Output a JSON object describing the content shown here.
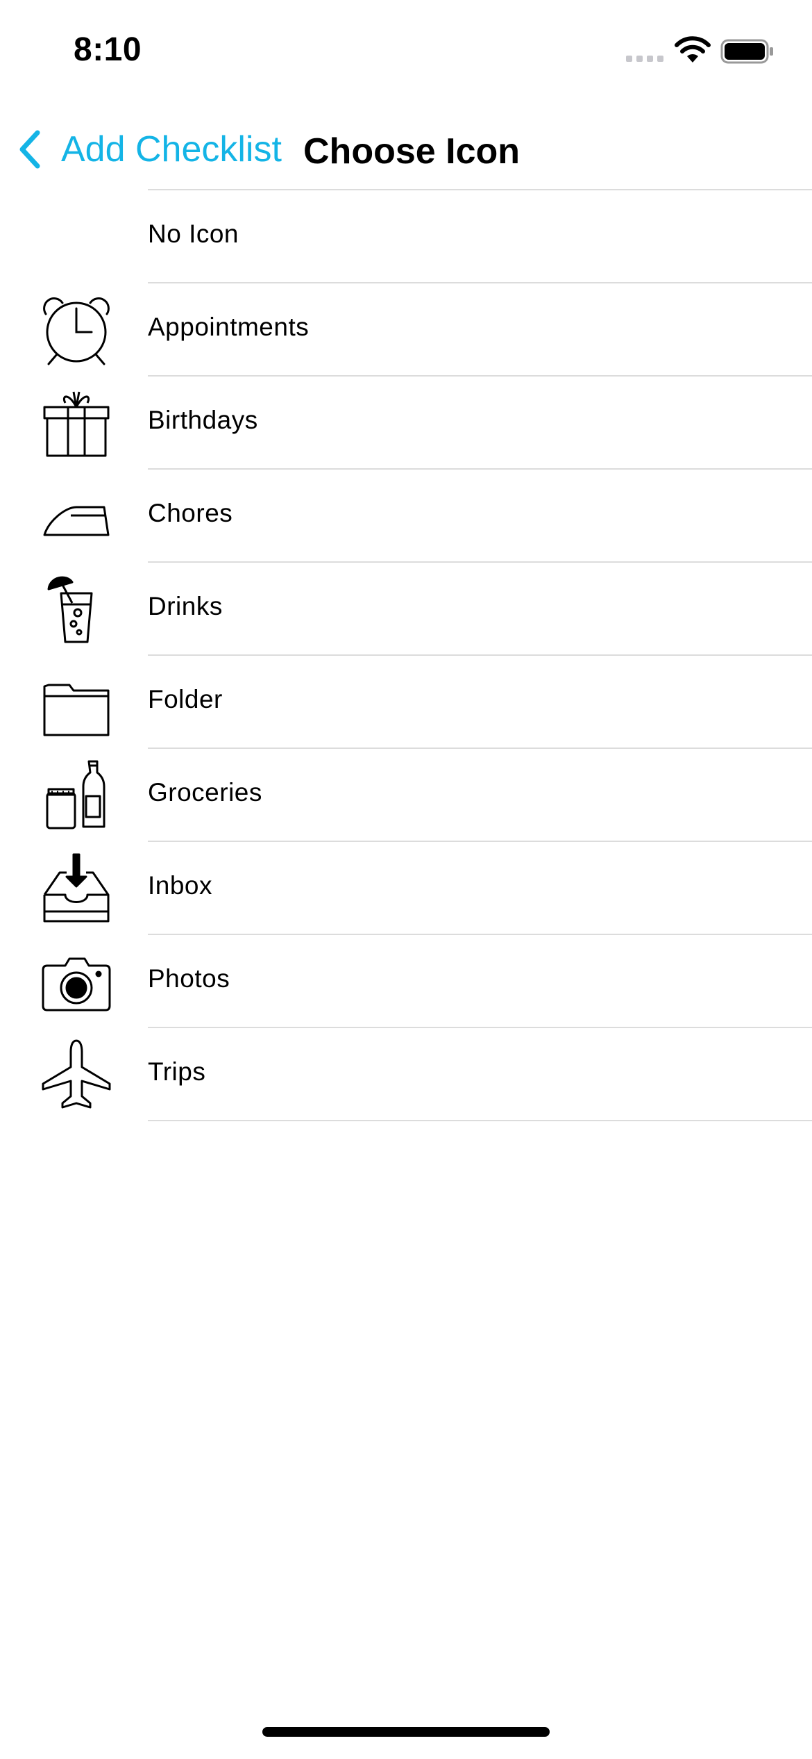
{
  "status_bar": {
    "time": "8:10",
    "icons": [
      "cellular-signal-icon",
      "wifi-icon",
      "battery-icon"
    ]
  },
  "nav": {
    "back_label": "Add Checklist",
    "title": "Choose Icon",
    "accent_color": "#14b4e6"
  },
  "icons": {
    "items": [
      {
        "label": "No Icon",
        "icon": "none"
      },
      {
        "label": "Appointments",
        "icon": "alarm-clock-icon"
      },
      {
        "label": "Birthdays",
        "icon": "gift-icon"
      },
      {
        "label": "Chores",
        "icon": "iron-icon"
      },
      {
        "label": "Drinks",
        "icon": "cocktail-icon"
      },
      {
        "label": "Folder",
        "icon": "folder-icon"
      },
      {
        "label": "Groceries",
        "icon": "groceries-icon"
      },
      {
        "label": "Inbox",
        "icon": "inbox-icon"
      },
      {
        "label": "Photos",
        "icon": "camera-icon"
      },
      {
        "label": "Trips",
        "icon": "airplane-icon"
      }
    ]
  }
}
